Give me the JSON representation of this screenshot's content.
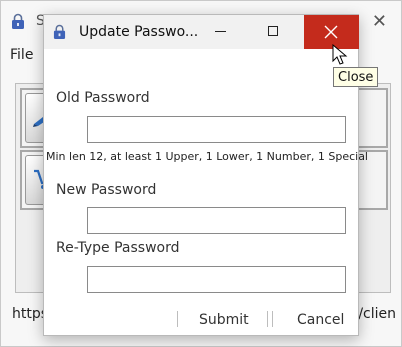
{
  "background_window": {
    "title": "S",
    "menu": [
      "File"
    ],
    "url_left": "https",
    "url_right": "/clien"
  },
  "dialog": {
    "title": "Update Passwo...",
    "old_password_label": "Old Password",
    "hint": "Min len 12, at least 1 Upper, 1 Lower, 1 Number, 1 Special",
    "new_password_label": "New Password",
    "retype_password_label": "Re-Type Password",
    "submit_label": "Submit",
    "cancel_label": "Cancel",
    "old_password_value": "",
    "new_password_value": "",
    "retype_password_value": ""
  },
  "tooltip": {
    "text": "Close"
  },
  "colors": {
    "close_hover": "#c42b1c",
    "tooltip_bg": "#ffffe6"
  },
  "icons": [
    "lock-icon",
    "minimize-icon",
    "maximize-icon",
    "close-icon",
    "cursor-icon"
  ]
}
